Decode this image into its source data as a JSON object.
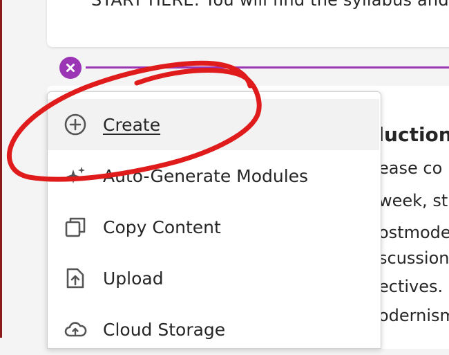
{
  "top_card": {
    "text": "START HERE: You will find the syllabus and"
  },
  "background": {
    "heading": "duction",
    "lines": [
      "ease co",
      "week, st",
      "ostmode",
      "scussion",
      "ectives. S",
      "odernism"
    ]
  },
  "menu": {
    "items": [
      {
        "label": "Create",
        "icon": "plus-circle-icon"
      },
      {
        "label": "Auto-Generate Modules",
        "icon": "sparkle-icon"
      },
      {
        "label": "Copy Content",
        "icon": "copy-icon"
      },
      {
        "label": "Upload",
        "icon": "upload-icon"
      },
      {
        "label": "Cloud Storage",
        "icon": "cloud-icon"
      }
    ]
  },
  "colors": {
    "accent_purple": "#9b35b5",
    "annotation_red": "#e01b1b",
    "left_border": "#8a1c1c"
  }
}
